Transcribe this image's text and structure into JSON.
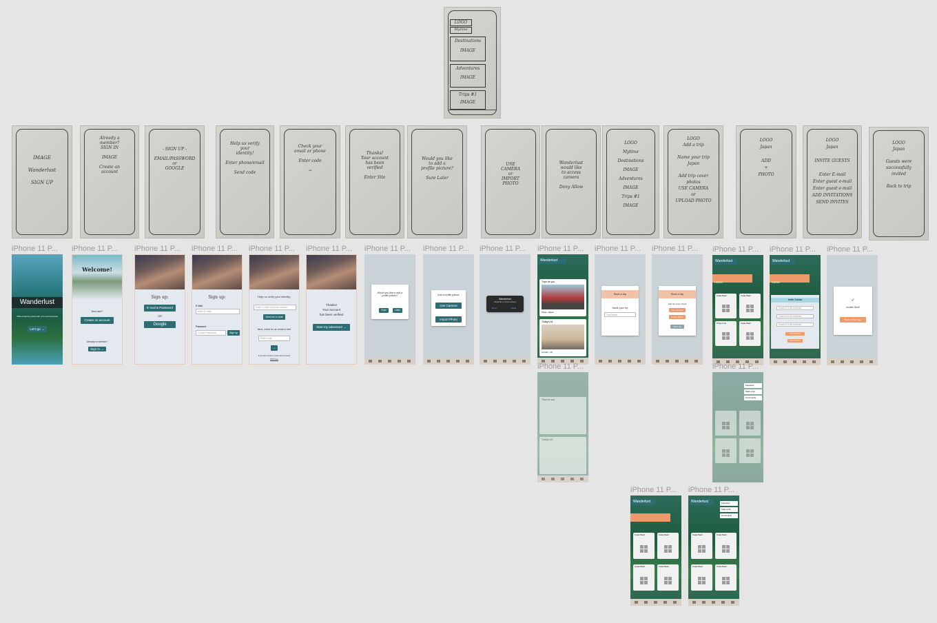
{
  "sketches": {
    "top": {
      "logo": "LOGO",
      "tab": "Mytime",
      "item1": "Destinations",
      "img": "IMAGE",
      "item2": "Adventures",
      "item3": "Trips #1"
    },
    "s1": {
      "lines": "IMAGE\n\nWanderlust\n\nSIGN UP"
    },
    "s2": {
      "lines": "Already a\nmember?\nSIGN IN\n\nIMAGE\n\nCreate an\naccount"
    },
    "s3": {
      "lines": "- SIGN UP -\n\nEMAIL/PASSWORD\nor\nGOOGLE"
    },
    "s4": {
      "lines": "Help us verify\nyour\nidentity!\n\nEnter phone/email\n\nSend code"
    },
    "s5": {
      "lines": "Check your\nemail or phone\n\nEnter code\n\n→"
    },
    "s6": {
      "lines": "Thanks!\nYour account\nhas been\nverified\n\nEnter Site"
    },
    "s7": {
      "lines": "Would you like\nto add a\nprofile picture?\n\nSure  Later"
    },
    "s8": {
      "lines": "USE\nCAMERA\nor\nIMPORT\nPHOTO"
    },
    "s9": {
      "lines": "Wanderlust\nwould like\nto access\ncamera\n\nDeny  Allow"
    },
    "s10": {
      "lines": "LOGO\nMytime\nDestinations\nIMAGE\nAdventures\nIMAGE\nTrips #1\nIMAGE"
    },
    "s11": {
      "lines": "LOGO\nAdd a trip\n\nName your trip\nJapan\n\nAdd trip cover\nphotos\nUSE CAMERA\nor\nUPLOAD PHOTO"
    },
    "s12": {
      "lines": "LOGO\nJapan\n\nADD\n+\nPHOTO"
    },
    "s13": {
      "lines": "LOGO\nJapan\n\nINVITE GUESTS\n\nEnter E-mail\nEnter guest e-mail\nEnter guest e-mail\nADD INVITATIONS\nSEND INVITES"
    },
    "s14": {
      "lines": "LOGO\nJapan\n\nGuests were\nsuccessfully\ninvited\n\nBack to trip"
    }
  },
  "frame_label": "iPhone 11 P...",
  "screens": {
    "welcome_splash": {
      "title": "Wanderlust",
      "tagline": "Make amazing travel with a fun and personal",
      "cta": "Let's go"
    },
    "welcome": {
      "title": "Welcome!",
      "new_user": "New user?",
      "create": "Create an account",
      "already": "Already a member?",
      "signin": "Sign in"
    },
    "signup": {
      "title": "Sign up:",
      "email_pw": "E-mail & Password",
      "or": "OR",
      "google": "Google"
    },
    "signup_email": {
      "title": "Sign up:",
      "email_label": "E-Mail",
      "email_ph": "Enter E-mail",
      "pw_label": "Password",
      "pw_ph": "Create Password",
      "signup": "Sign up"
    },
    "verify": {
      "title": "Help us verify your identity:",
      "input_ph": "Enter e-mail or phone number",
      "send": "Send me a code",
      "check": "Next, check for an email or text",
      "code_ph": "Enter code",
      "go": "→",
      "resend": "If you didn't receive a code click to resend",
      "resend_link": "click here"
    },
    "verified": {
      "line1": "Thanks!",
      "line2": "Your account",
      "line3": "has been verified",
      "cta": "Start my adventure"
    },
    "profile_prompt": {
      "question": "Would you like to add a profile picture?",
      "sure": "Sure",
      "later": "Later"
    },
    "profile_choice": {
      "title": "Add a profile picture",
      "camera": "Use Camera",
      "import": "Import Photo"
    },
    "camera_perm": {
      "title": "Wanderlust",
      "body": "Would like to access camera",
      "deny": "Deny",
      "allow": "Allow"
    },
    "home": {
      "brand": "Wanderlust",
      "trips_for_you": "Trips for you",
      "trip1": "Tokyo, Japan",
      "todays": "Today's #1",
      "trip2": "London, UK"
    },
    "start_trip": {
      "title": "Start a trip",
      "name_label": "Name your trip",
      "name_ph": "Trip Name"
    },
    "start_trip_photo": {
      "title": "Start a trip",
      "add_cover": "Add trip cover photo",
      "camera": "Use camera",
      "import": "Import Photo",
      "save": "Save trip"
    },
    "trip_board": {
      "brand": "Wanderlust",
      "trip": "PARIS",
      "create_board": "Create Board",
      "things": "Things to do"
    },
    "invite": {
      "brand": "Wanderlust",
      "trip": "PARIS",
      "header": "Invite Guests",
      "ph": "Guest e-mail address",
      "add": "Add invitation",
      "send": "Send invites"
    },
    "invite_done": {
      "msg": "Invites Sent!",
      "back": "Back to Trip Page"
    },
    "menu": {
      "favorites": "Favorites",
      "start_trip": "Start a trip",
      "community": "Community"
    }
  },
  "colors": {
    "teal": "#2b6d72",
    "peach": "#f0c2a7",
    "orange": "#ef9a6a",
    "canvas": "#e5e5e5"
  }
}
